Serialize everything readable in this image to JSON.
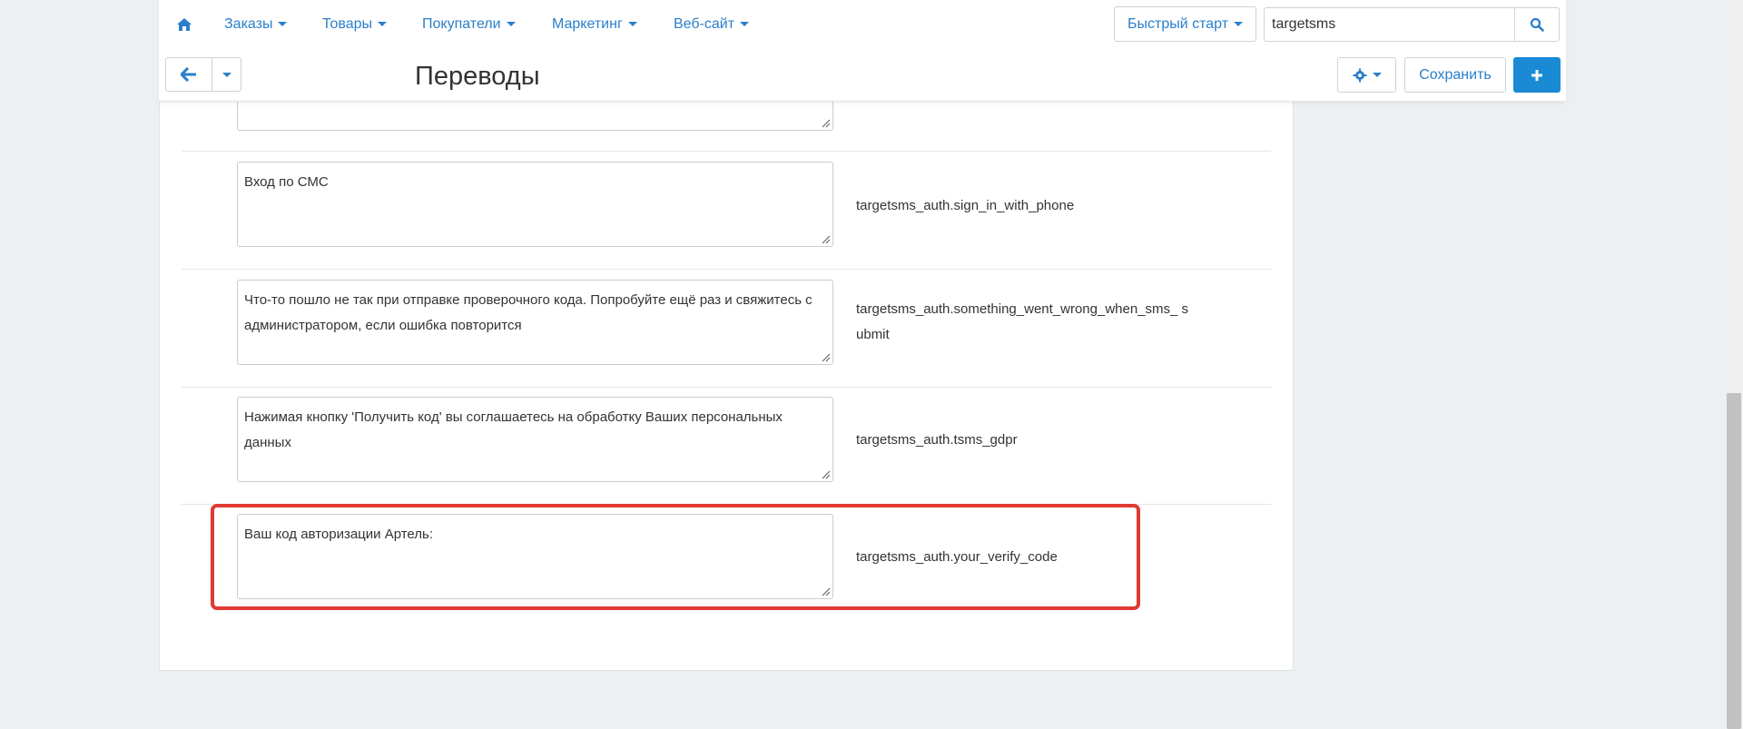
{
  "nav": {
    "items": [
      {
        "label": "Заказы"
      },
      {
        "label": "Товары"
      },
      {
        "label": "Покупатели"
      },
      {
        "label": "Маркетинг"
      },
      {
        "label": "Веб-сайт"
      }
    ],
    "quick_start_label": "Быстрый старт",
    "search_value": "targetsms"
  },
  "toolbar": {
    "title": "Переводы",
    "save_label": "Сохранить"
  },
  "rows": [
    {
      "value": "",
      "key": ""
    },
    {
      "value": "Вход по СМС",
      "key": "targetsms_auth.sign_in_with_phone"
    },
    {
      "value": "Что-то пошло не так при отправке проверочного кода. Попробуйте ещё раз и свяжитесь с администратором, если ошибка повторится",
      "key": "targetsms_auth.something_went_wrong_when_sms_ submit"
    },
    {
      "value": "Нажимая кнопку 'Получить код' вы соглашаетесь на обработку Ваших персональных данных",
      "key": "targetsms_auth.tsms_gdpr"
    },
    {
      "value": "Ваш код авторизации Артель:",
      "key": "targetsms_auth.your_verify_code"
    }
  ],
  "icons": {
    "home": "home-icon",
    "search": "search-icon",
    "back": "arrow-left-icon",
    "dropdown": "chevron-down-icon",
    "settings": "gear-icon",
    "add": "plus-icon"
  },
  "colors": {
    "accent": "#2a7fcb",
    "primary_button": "#1a8ad4",
    "highlight_border": "#e03a32"
  }
}
